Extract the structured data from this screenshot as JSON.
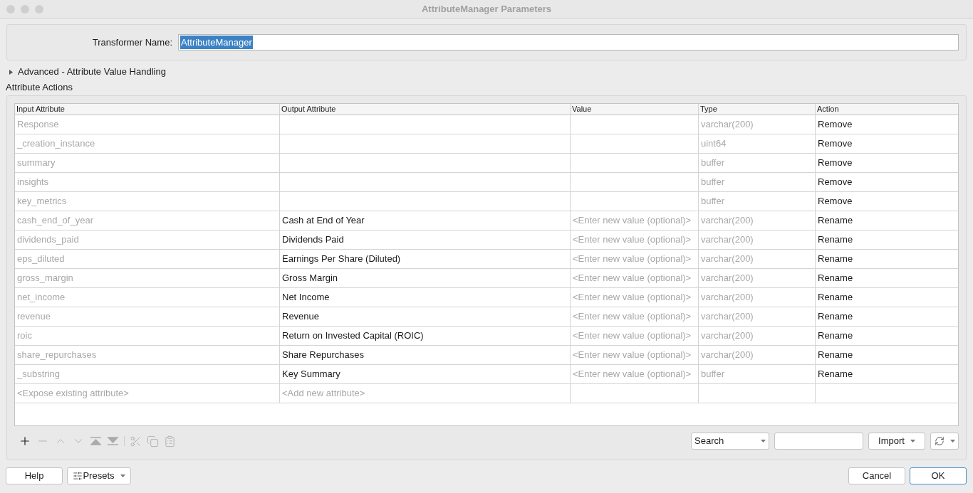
{
  "window": {
    "title": "AttributeManager Parameters"
  },
  "transformer_name": {
    "label": "Transformer Name:",
    "value": "AttributeManager"
  },
  "advanced": {
    "label": "Advanced - Attribute Value Handling",
    "expanded": false
  },
  "section_title": "Attribute Actions",
  "table": {
    "columns": [
      "Input Attribute",
      "Output Attribute",
      "Value",
      "Type",
      "Action"
    ],
    "rows": [
      {
        "kind": "attribute",
        "input": "Response",
        "type": "varchar(200)",
        "action": "Remove"
      },
      {
        "kind": "attribute",
        "input": "_creation_instance",
        "type": "uint64",
        "action": "Remove"
      },
      {
        "kind": "attribute",
        "input": "summary",
        "type": "buffer",
        "action": "Remove"
      },
      {
        "kind": "attribute",
        "input": "insights",
        "type": "buffer",
        "action": "Remove"
      },
      {
        "kind": "attribute",
        "input": "key_metrics",
        "type": "buffer",
        "action": "Remove"
      },
      {
        "kind": "attribute",
        "input": "cash_end_of_year",
        "output": "Cash at End of Year",
        "value": "<Enter new value (optional)>",
        "type": "varchar(200)",
        "action": "Rename"
      },
      {
        "kind": "attribute",
        "input": "dividends_paid",
        "output": "Dividends Paid",
        "value": "<Enter new value (optional)>",
        "type": "varchar(200)",
        "action": "Rename"
      },
      {
        "kind": "attribute",
        "input": "eps_diluted",
        "output": "Earnings Per Share (Diluted)",
        "value": "<Enter new value (optional)>",
        "type": "varchar(200)",
        "action": "Rename"
      },
      {
        "kind": "attribute",
        "input": "gross_margin",
        "output": "Gross Margin",
        "value": "<Enter new value (optional)>",
        "type": "varchar(200)",
        "action": "Rename"
      },
      {
        "kind": "attribute",
        "input": "net_income",
        "output": "Net Income",
        "value": "<Enter new value (optional)>",
        "type": "varchar(200)",
        "action": "Rename"
      },
      {
        "kind": "attribute",
        "input": "revenue",
        "output": "Revenue",
        "value": "<Enter new value (optional)>",
        "type": "varchar(200)",
        "action": "Rename"
      },
      {
        "kind": "attribute",
        "input": "roic",
        "output": "Return on Invested Capital (ROIC)",
        "value": "<Enter new value (optional)>",
        "type": "varchar(200)",
        "action": "Rename"
      },
      {
        "kind": "attribute",
        "input": "share_repurchases",
        "output": "Share Repurchases",
        "value": "<Enter new value (optional)>",
        "type": "varchar(200)",
        "action": "Rename"
      },
      {
        "kind": "attribute",
        "input": "_substring",
        "output": "Key Summary",
        "value": "<Enter new value (optional)>",
        "type": "buffer",
        "action": "Rename"
      },
      {
        "kind": "new",
        "input": "<Expose existing attribute>",
        "output": "<Add new attribute>"
      }
    ]
  },
  "search": {
    "mode": "Search"
  },
  "import_button": "Import",
  "buttons": {
    "help": "Help",
    "presets": "Presets",
    "cancel": "Cancel",
    "ok": "OK"
  }
}
